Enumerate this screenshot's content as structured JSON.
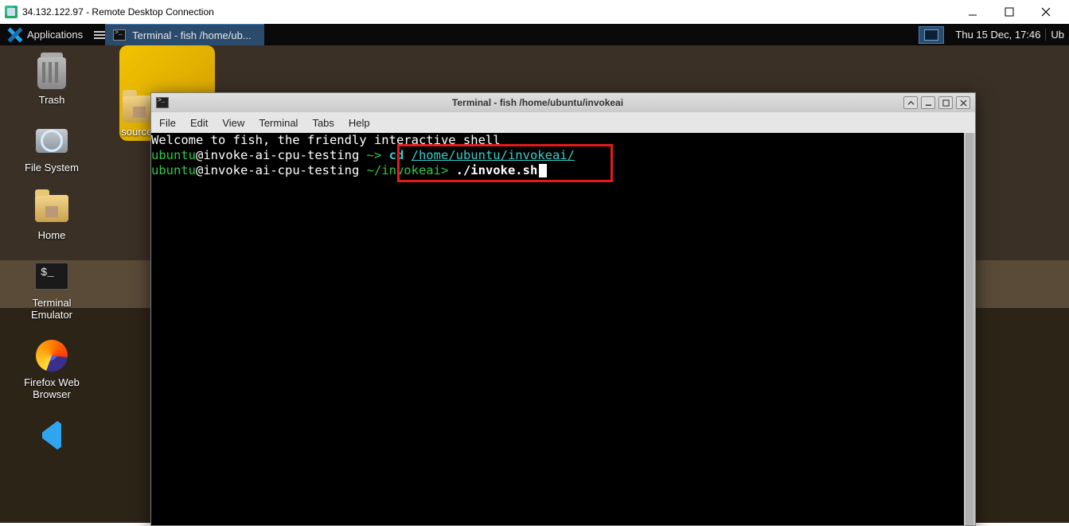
{
  "rdp": {
    "title": "34.132.122.97 - Remote Desktop Connection"
  },
  "panel": {
    "applications": "Applications",
    "task_label": "Terminal - fish /home/ub...",
    "clock": "Thu 15 Dec, 17:46",
    "user_fragment": "Ub"
  },
  "desktop_icons": {
    "trash": "Trash",
    "filesystem": "File System",
    "home": "Home",
    "terminal_line1": "Terminal",
    "terminal_line2": "Emulator",
    "firefox_line1": "Firefox Web",
    "firefox_line2": "Browser",
    "sourcecode": "sourcec"
  },
  "terminal": {
    "title": "Terminal - fish /home/ubuntu/invokeai",
    "menu": {
      "file": "File",
      "edit": "Edit",
      "view": "View",
      "terminal": "Terminal",
      "tabs": "Tabs",
      "help": "Help"
    },
    "content": {
      "welcome": "Welcome to fish, the friendly interactive shell",
      "line1": {
        "user": "ubuntu",
        "at": "@",
        "host": "invoke-ai-cpu-testing",
        "sep": " ~> ",
        "cmd": "cd ",
        "path": "/home/ubuntu/invokeai/"
      },
      "line2": {
        "user": "ubuntu",
        "at": "@",
        "host": "invoke-ai-cpu-testing",
        "sep": " ~/",
        "cwd": "invokeai",
        "arrow": "> ",
        "cmd": "./invoke.sh"
      }
    }
  }
}
